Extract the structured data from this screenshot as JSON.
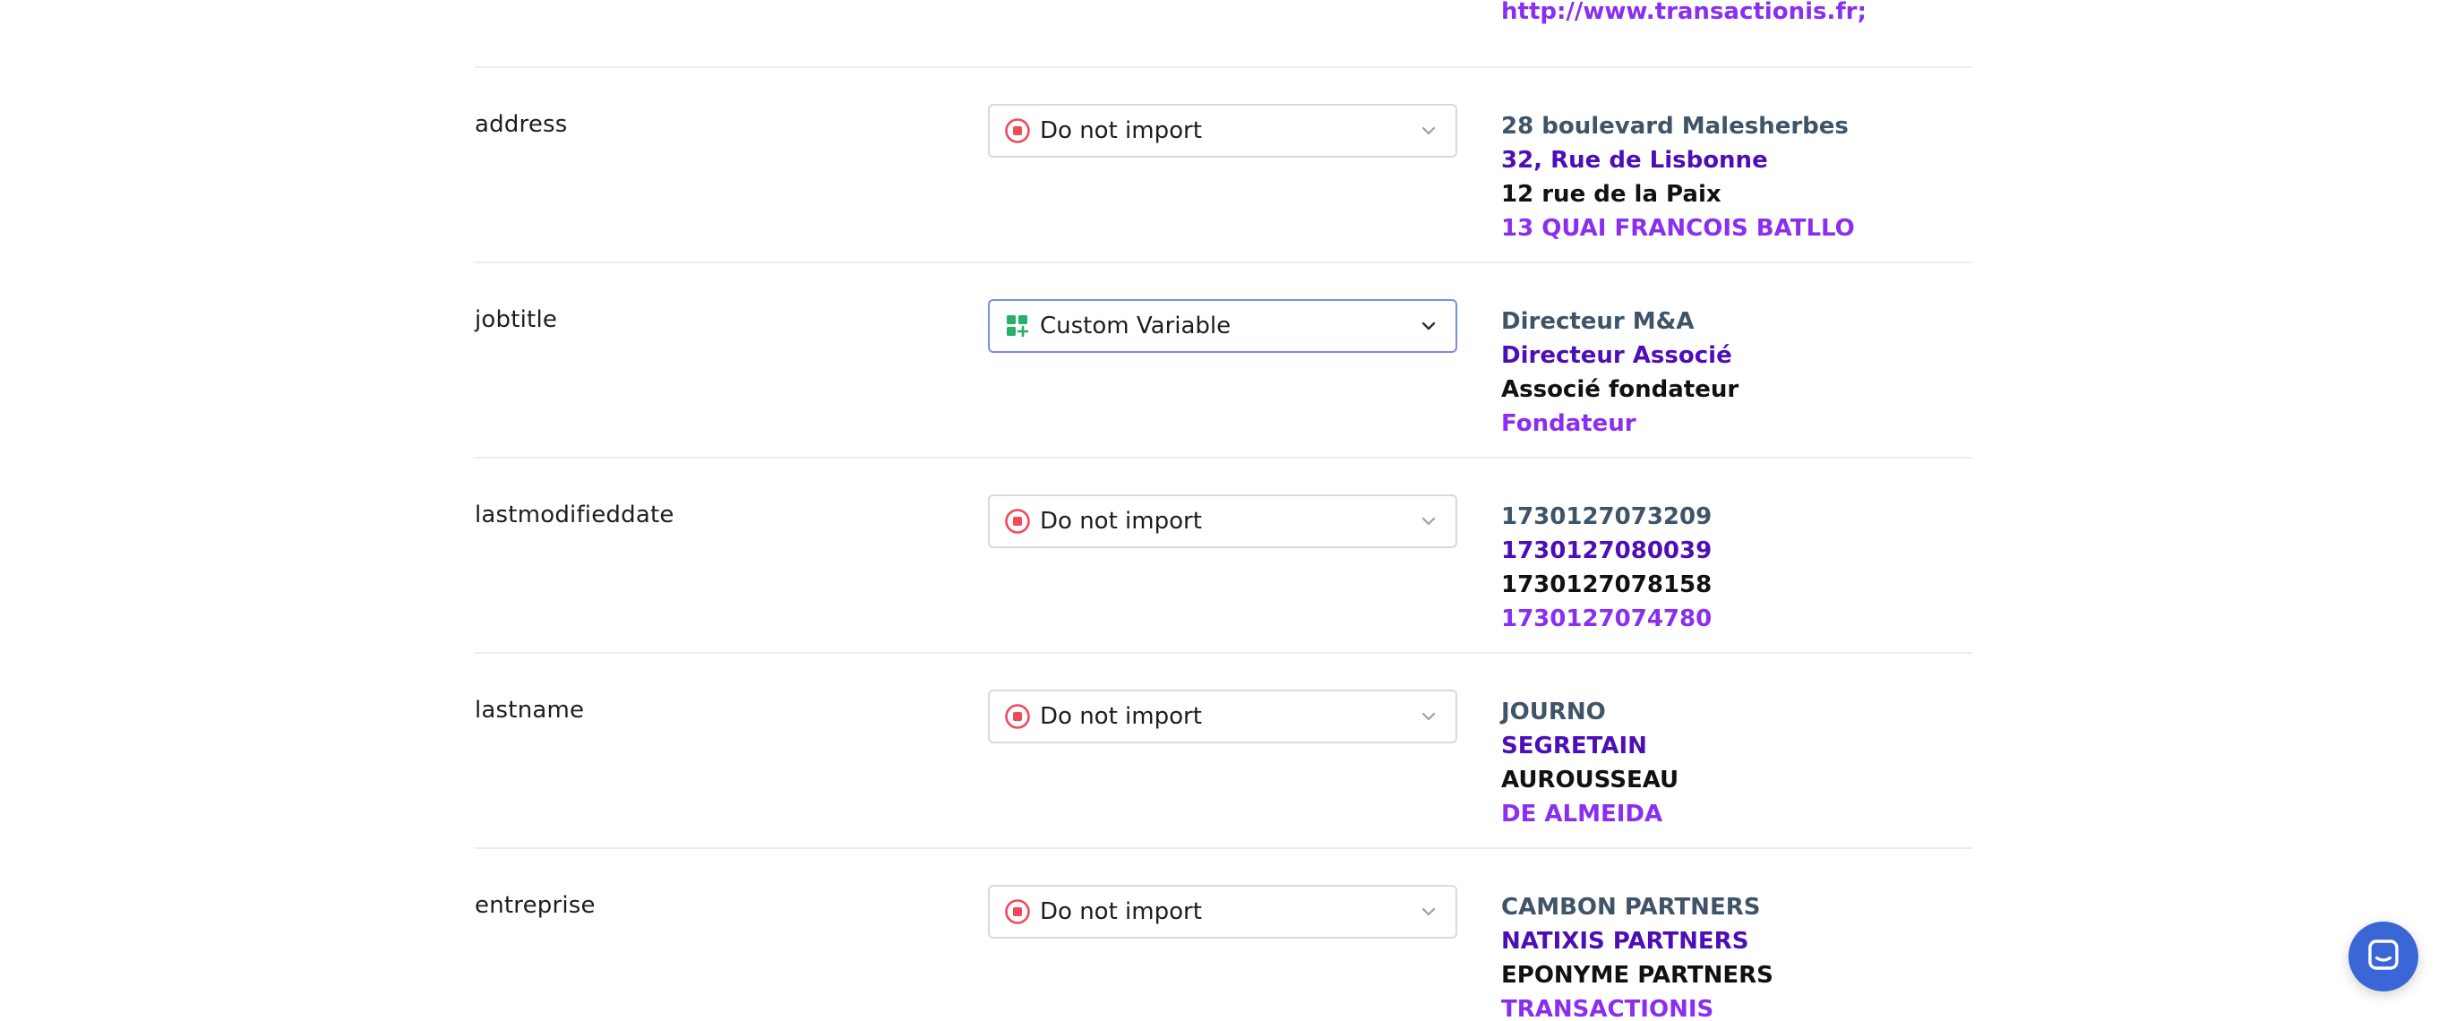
{
  "rows": [
    {
      "field": "",
      "selection": "",
      "icon": "",
      "samples": [
        "http://www.transactionis.fr;"
      ]
    },
    {
      "field": "address",
      "selection": "Do not import",
      "icon": "stop-circle-icon",
      "samples": [
        "28 boulevard Malesherbes",
        "32, Rue de Lisbonne",
        "12 rue de la Paix",
        "13 QUAI FRANCOIS BATLLO"
      ]
    },
    {
      "field": "jobtitle",
      "selection": "Custom Variable",
      "icon": "custom-variable-icon",
      "samples": [
        "Directeur M&A",
        "Directeur Associé",
        "Associé fondateur",
        "Fondateur"
      ]
    },
    {
      "field": "lastmodifieddate",
      "selection": "Do not import",
      "icon": "stop-circle-icon",
      "samples": [
        "1730127073209",
        "1730127080039",
        "1730127078158",
        "1730127074780"
      ]
    },
    {
      "field": "lastname",
      "selection": "Do not import",
      "icon": "stop-circle-icon",
      "samples": [
        "JOURNO",
        "SEGRETAIN",
        "AUROUSSEAU",
        "DE ALMEIDA"
      ]
    },
    {
      "field": "entreprise",
      "selection": "Do not import",
      "icon": "stop-circle-icon",
      "samples": [
        "CAMBON PARTNERS",
        "NATIXIS PARTNERS",
        "EPONYME PARTNERS",
        "TRANSACTIONIS"
      ]
    }
  ],
  "colors": {
    "sample_colors": [
      "#3f5468",
      "#4d0fb5",
      "#111111",
      "#8a2ef0"
    ],
    "stop_icon": "#f04a5a",
    "custom_variable_icon": "#27b06a",
    "active_border": "#7b8ce8",
    "chat_launcher": "#3b66d6"
  },
  "chat_launcher": {
    "icon": "chat-icon"
  }
}
